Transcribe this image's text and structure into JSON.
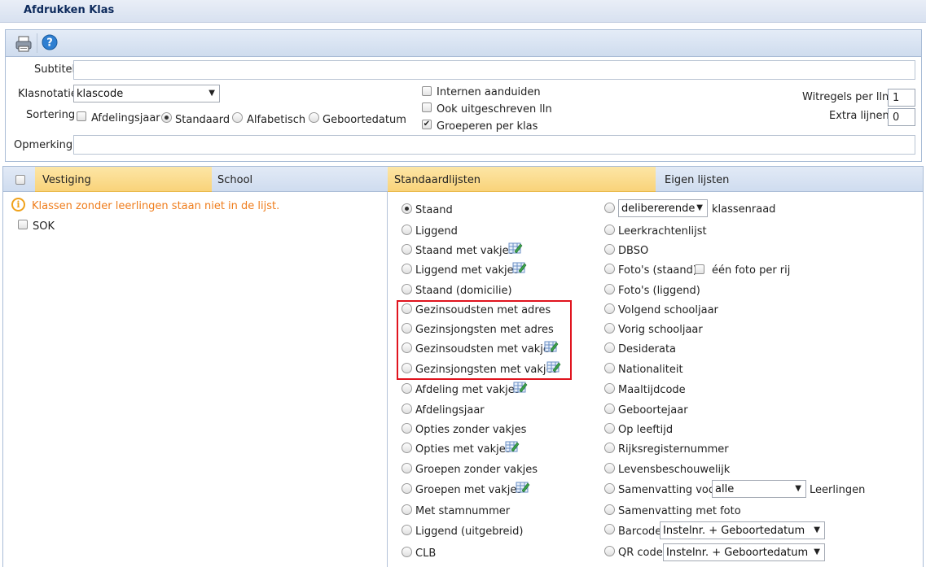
{
  "window": {
    "title": "Afdrukken Klas"
  },
  "toolbar": {
    "print_icon": "printer-icon",
    "help_icon": "help-icon"
  },
  "form": {
    "subtitle_label": "Subtitel",
    "subtitle_value": "",
    "klasnotatie_label": "Klasnotatie",
    "klasnotatie_value": "klascode",
    "sortering_label": "Sortering",
    "sort_options": [
      {
        "label": "Afdelingsjaar",
        "type": "checkbox",
        "checked": false
      },
      {
        "label": "Standaard",
        "type": "radio",
        "checked": true
      },
      {
        "label": "Alfabetisch",
        "type": "radio",
        "checked": false
      },
      {
        "label": "Geboortedatum",
        "type": "radio",
        "checked": false
      }
    ],
    "opmerking_label": "Opmerking",
    "opmerking_value": "",
    "options": [
      {
        "label": "Internen aanduiden",
        "checked": false
      },
      {
        "label": "Ook uitgeschreven lln",
        "checked": false
      },
      {
        "label": "Groeperen per klas",
        "checked": true
      }
    ],
    "witregels_label": "Witregels per lln",
    "witregels_value": "1",
    "extra_lijnen_label": "Extra lijnen",
    "extra_lijnen_value": "0"
  },
  "tabs": {
    "vestiging": "Vestiging",
    "school": "School",
    "standaardlijsten": "Standaardlijsten",
    "eigen_lijsten": "Eigen lijsten"
  },
  "left": {
    "warning": "Klassen zonder leerlingen staan niet in de lijst.",
    "items": [
      {
        "label": "SOK",
        "checked": false
      }
    ]
  },
  "standard_lists": [
    {
      "label": "Staand",
      "selected": true,
      "icon": false
    },
    {
      "label": "Liggend",
      "selected": false,
      "icon": false
    },
    {
      "label": "Staand met vakjes",
      "selected": false,
      "icon": true
    },
    {
      "label": "Liggend met vakjes",
      "selected": false,
      "icon": true
    },
    {
      "label": "Staand (domicilie)",
      "selected": false,
      "icon": false
    },
    {
      "label": "Gezinsoudsten met adres",
      "selected": false,
      "icon": false
    },
    {
      "label": "Gezinsjongsten met adres",
      "selected": false,
      "icon": false
    },
    {
      "label": "Gezinsoudsten met vakjes",
      "selected": false,
      "icon": true
    },
    {
      "label": "Gezinsjongsten met vakjes",
      "selected": false,
      "icon": true
    },
    {
      "label": "Afdeling met vakjes",
      "selected": false,
      "icon": true
    },
    {
      "label": "Afdelingsjaar",
      "selected": false,
      "icon": false
    },
    {
      "label": "Opties zonder vakjes",
      "selected": false,
      "icon": false
    },
    {
      "label": "Opties met vakjes",
      "selected": false,
      "icon": true
    },
    {
      "label": "Groepen zonder vakjes",
      "selected": false,
      "icon": false
    },
    {
      "label": "Groepen met vakjes",
      "selected": false,
      "icon": true
    },
    {
      "label": "Met stamnummer",
      "selected": false,
      "icon": false
    },
    {
      "label": "Liggend (uitgebreid)",
      "selected": false,
      "icon": false
    },
    {
      "label": "CLB",
      "selected": false,
      "icon": false
    }
  ],
  "own_lists": {
    "klassenraad_select": "delibererende",
    "klassenraad_label": "klassenraad",
    "leerkrachtenlijst": "Leerkrachtenlijst",
    "dbso": "DBSO",
    "fotos_staand": "Foto's (staand)",
    "een_foto_per_rij": "één foto per rij",
    "fotos_liggend": "Foto's (liggend)",
    "volgend_schooljaar": "Volgend schooljaar",
    "vorig_schooljaar": "Vorig schooljaar",
    "desiderata": "Desiderata",
    "nationaliteit": "Nationaliteit",
    "maaltijdcode": "Maaltijdcode",
    "geboortejaar": "Geboortejaar",
    "op_leeftijd": "Op leeftijd",
    "rijksregisternummer": "Rijksregisternummer",
    "levensbeschouwelijk": "Levensbeschouwelijk",
    "samenvatting_voor": "Samenvatting voor",
    "samenvatting_select": "alle",
    "leerlingen": "Leerlingen",
    "samenvatting_met_foto": "Samenvatting met foto",
    "barcode": "Barcode",
    "barcode_select": "Instelnr. + Geboortedatum",
    "qr_code": "QR code",
    "qr_select": "Instelnr. + Geboortedatum"
  },
  "colors": {
    "accent_tab": "#f9d37a",
    "warning": "#ef7d1c",
    "highlight": "#e0141e"
  }
}
